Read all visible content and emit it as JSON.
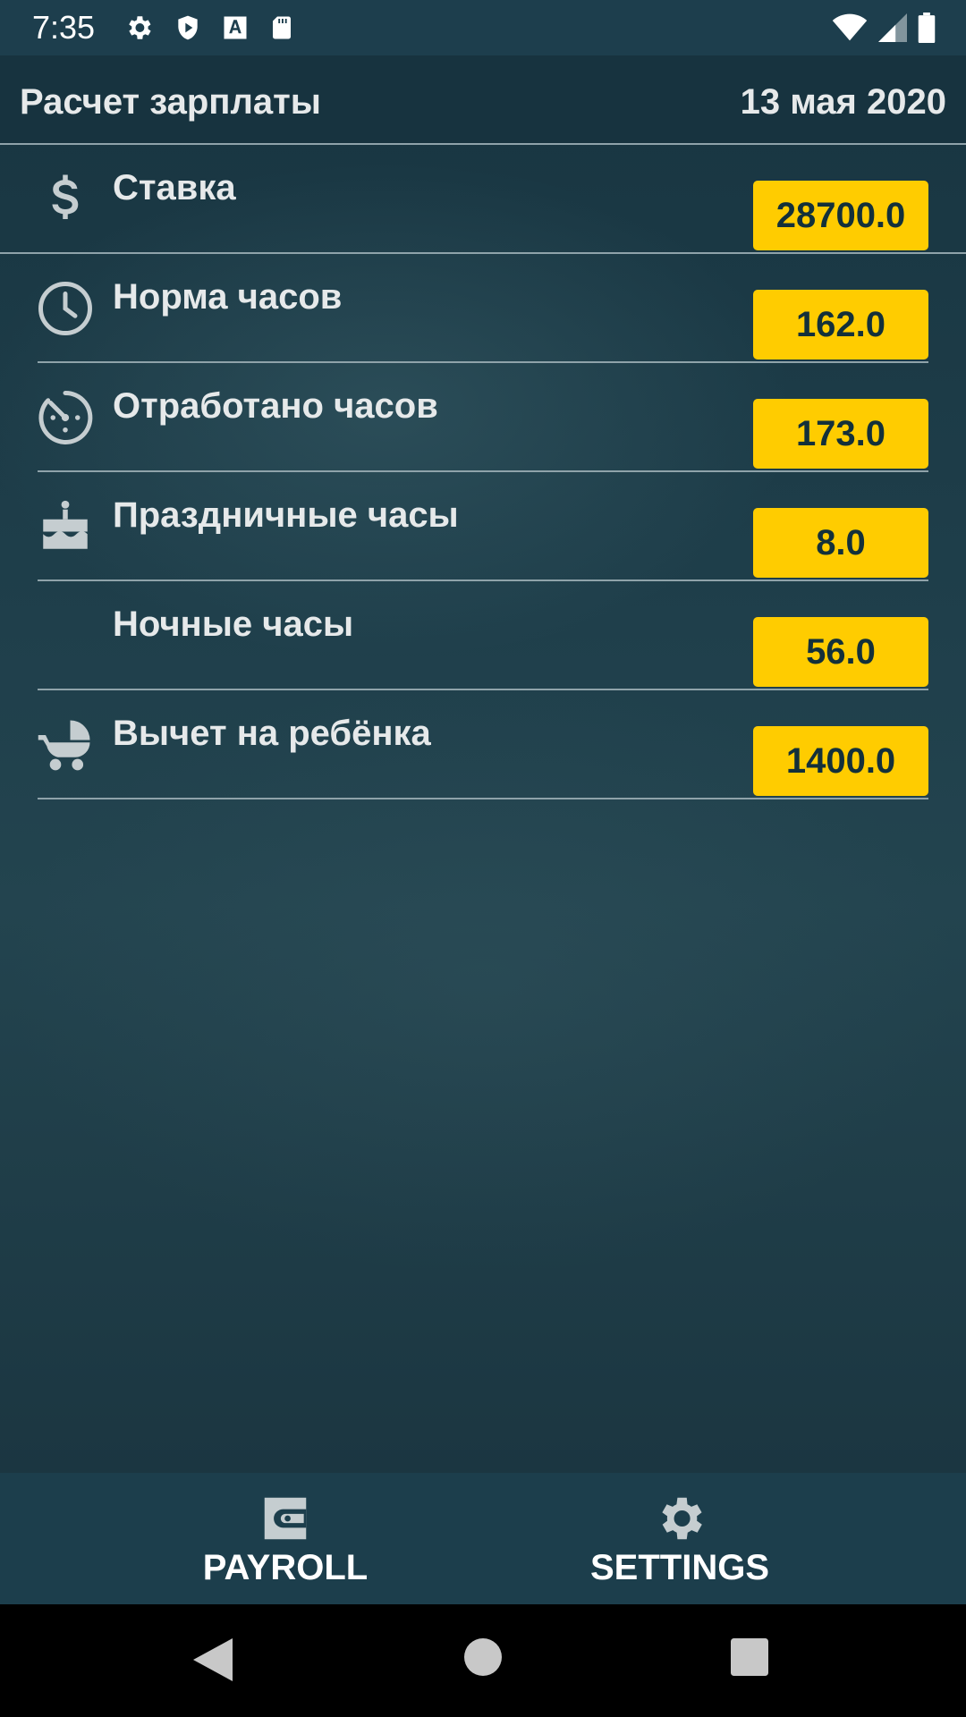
{
  "status_bar": {
    "time": "7:35",
    "left_icons": [
      "settings-icon",
      "shield-icon",
      "font-icon",
      "sd-card-icon"
    ],
    "right_icons": [
      "wifi-icon",
      "cell-signal-icon",
      "battery-icon"
    ]
  },
  "header": {
    "title": "Расчет зарплаты",
    "date": "13 мая 2020"
  },
  "rows": [
    {
      "icon": "dollar-icon",
      "label": "Ставка",
      "value": "28700.0"
    },
    {
      "icon": "clock-icon",
      "label": "Норма часов",
      "value": "162.0"
    },
    {
      "icon": "timer-icon",
      "label": "Отработано часов",
      "value": "173.0"
    },
    {
      "icon": "cake-icon",
      "label": "Праздничные часы",
      "value": "8.0"
    },
    {
      "icon": "moon-icon",
      "label": "Ночные часы",
      "value": "56.0"
    },
    {
      "icon": "stroller-icon",
      "label": "Вычет на ребёнка",
      "value": "1400.0"
    }
  ],
  "bottom_nav": {
    "items": [
      {
        "icon": "wallet-icon",
        "label": "PAYROLL"
      },
      {
        "icon": "gear-icon",
        "label": "SETTINGS"
      }
    ]
  },
  "system_nav": [
    "back-icon",
    "home-icon",
    "recents-icon"
  ],
  "colors": {
    "accent": "#ffcc00",
    "background": "#1e3a46",
    "divider": "#8fa3aa",
    "text": "#e6e9ea"
  }
}
